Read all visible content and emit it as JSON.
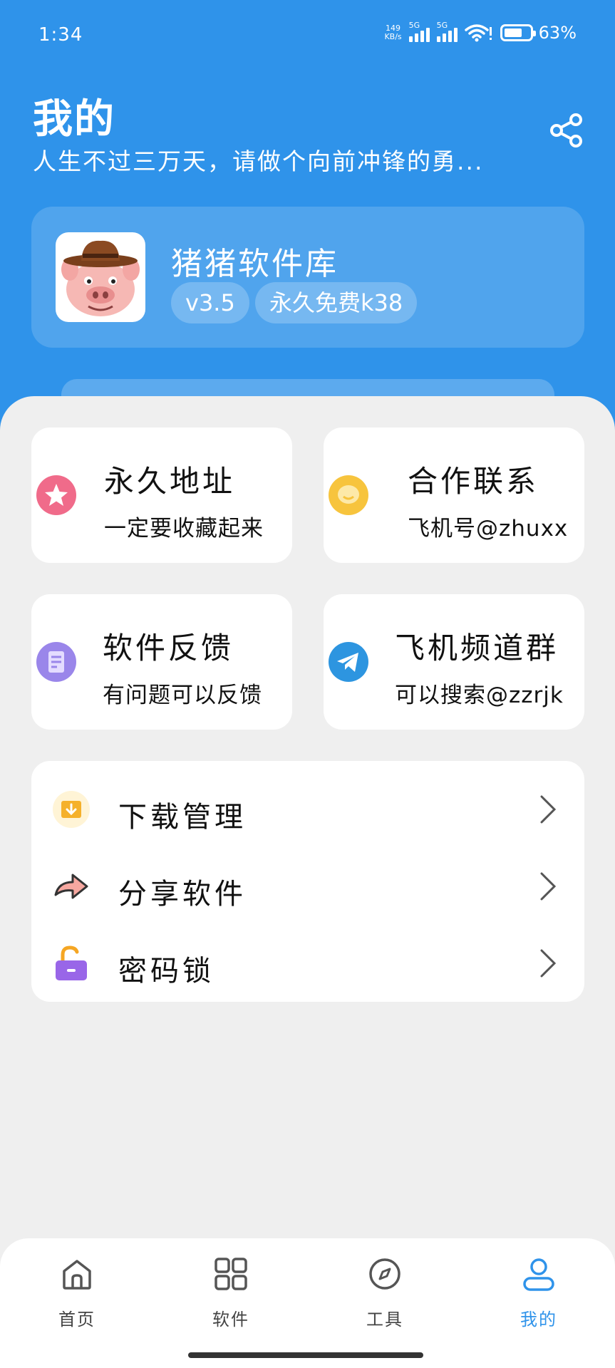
{
  "status_bar": {
    "time": "1:34",
    "net_speed_value": "149",
    "net_speed_unit": "KB/s",
    "sim1_label": "5G",
    "sim2_label": "5G",
    "battery": "63%"
  },
  "header": {
    "title": "我的",
    "subtitle": "人生不过三万天，请做个向前冲锋的勇..."
  },
  "profile": {
    "name": "猪猪软件库",
    "version": "v3.5",
    "tag": "永久免费k38"
  },
  "features": [
    {
      "title": "永久地址",
      "desc": "一定要收藏起来",
      "icon": "star-icon",
      "color": "#f06b8a"
    },
    {
      "title": "合作联系",
      "desc": "飞机号@zhuxx",
      "icon": "chat-bubble-icon",
      "color": "#f7c43d"
    },
    {
      "title": "软件反馈",
      "desc": "有问题可以反馈",
      "icon": "feedback-document-icon",
      "color": "#9a86ea"
    },
    {
      "title": "飞机频道群",
      "desc": "可以搜索@zzrjk",
      "icon": "telegram-icon",
      "color": "#2d95e0"
    }
  ],
  "menu": [
    {
      "label": "下载管理",
      "icon": "download-folder-icon"
    },
    {
      "label": "分享软件",
      "icon": "share-arrow-icon"
    },
    {
      "label": "密码锁",
      "icon": "unlocked-padlock-icon"
    }
  ],
  "nav": [
    {
      "label": "首页",
      "icon": "home-icon"
    },
    {
      "label": "软件",
      "icon": "grid-apps-icon"
    },
    {
      "label": "工具",
      "icon": "compass-icon"
    },
    {
      "label": "我的",
      "icon": "user-icon",
      "active": true
    }
  ],
  "colors": {
    "header_blue": "#2f93ea",
    "active_tab": "#2f93ea",
    "background": "#efefef"
  }
}
